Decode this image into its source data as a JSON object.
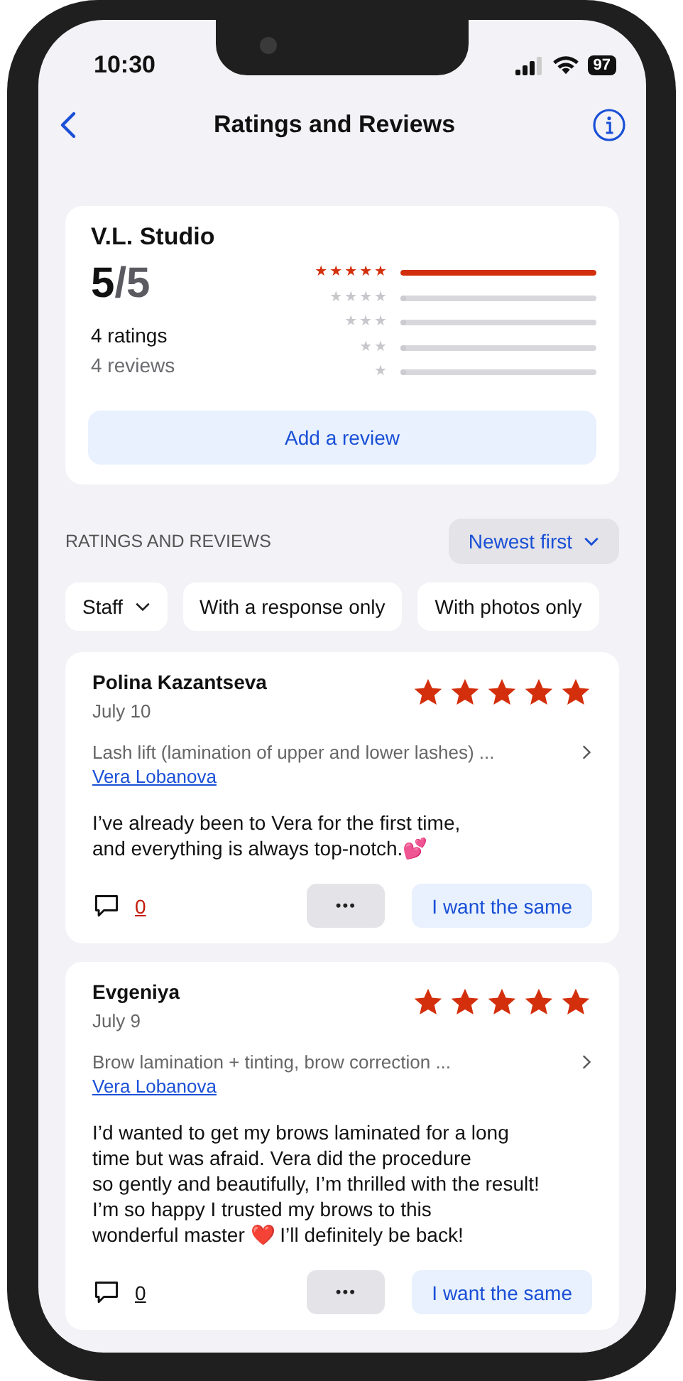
{
  "status_bar": {
    "time": "10:30",
    "battery": "97"
  },
  "nav": {
    "title": "Ratings and Reviews"
  },
  "summary": {
    "name": "V.L. Studio",
    "score": "5",
    "score_max": "/5",
    "ratings": "4 ratings",
    "reviews": "4 reviews",
    "distribution": [
      {
        "label": "★★★★★",
        "level": 1
      },
      {
        "label": "★★★★",
        "level": 0
      },
      {
        "label": "★★★",
        "level": 0
      },
      {
        "label": "★★",
        "level": 0
      },
      {
        "label": "★",
        "level": 0
      }
    ],
    "button": "Add a review"
  },
  "section": {
    "heading": "RATINGS AND REVIEWS",
    "sort": "Newest first"
  },
  "filters": [
    {
      "label": "Staff",
      "dropdown": true
    },
    {
      "label": "With a response only",
      "dropdown": false
    },
    {
      "label": "With photos only",
      "dropdown": false
    }
  ],
  "reviews": [
    {
      "author": "Polina Kazantseva",
      "date": "July 10",
      "stars": 5,
      "service": "Lash lift (lamination of upper and lower lashes) ...",
      "master": "Vera Lobanova",
      "text": [
        "I’ve already been to Vera for the first time,",
        "and everything is always top-notch.💕"
      ],
      "comments": "0",
      "comments_highlighted": true,
      "more": "•••",
      "action": "I want the same"
    },
    {
      "author": "Evgeniya",
      "date": "July 9",
      "stars": 5,
      "service": "Brow lamination + tinting, brow correction ...",
      "master": "Vera Lobanova",
      "text": [
        "I’d wanted to get my brows laminated for a long",
        "time but was afraid. Vera did the procedure",
        "so gently and beautifully, I’m thrilled with the result!",
        "I’m so happy I trusted my brows to this",
        "wonderful master ❤️ I’ll definitely be back!"
      ],
      "comments": "0",
      "comments_highlighted": false,
      "more": "•••",
      "action": "I want the same"
    }
  ]
}
